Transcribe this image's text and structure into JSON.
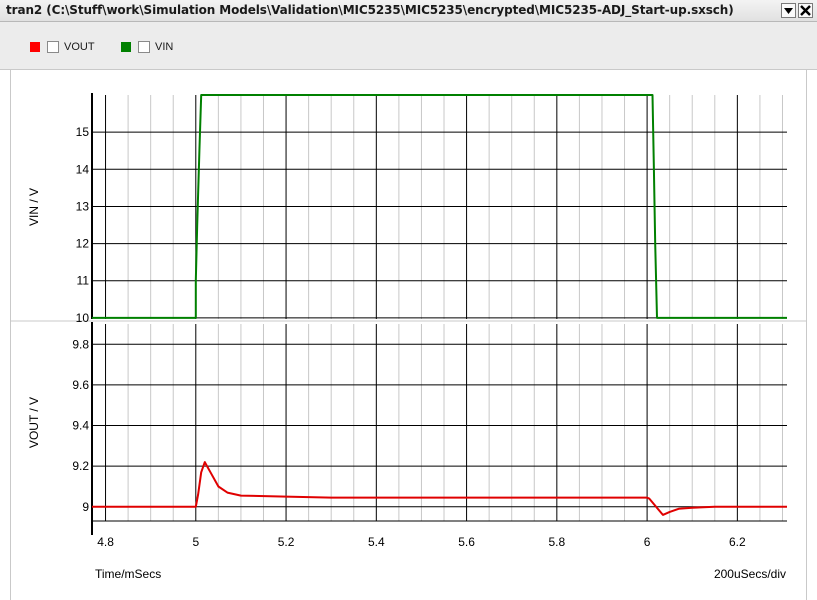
{
  "window": {
    "title": "tran2 (C:\\Stuff\\work\\Simulation Models\\Validation\\MIC5235\\MIC5235\\encrypted\\MIC5235-ADJ_Start-up.sxsch)",
    "menu_icon": "dropdown-triangle-icon",
    "close_icon": "close-x-icon"
  },
  "legend": [
    {
      "label": "VOUT",
      "color": "#ff0000",
      "checked": false
    },
    {
      "label": "VIN",
      "color": "#008000",
      "checked": false
    }
  ],
  "chart_data": [
    {
      "type": "line",
      "ylabel": "VIN / V",
      "yticks": [
        10,
        11,
        12,
        13,
        14,
        15
      ],
      "ylim": [
        9.97,
        16.0
      ],
      "xlim": [
        4.77,
        6.31
      ],
      "grid": true,
      "series": [
        {
          "name": "VIN",
          "color": "#008000",
          "x": [
            4.77,
            5.0,
            5.0,
            5.003,
            5.008,
            5.012,
            6.012,
            6.015,
            6.018,
            6.022,
            6.31
          ],
          "y": [
            10.0,
            10.0,
            11.0,
            12.5,
            14.5,
            16.0,
            16.0,
            14.0,
            12.0,
            10.0,
            10.0
          ]
        }
      ]
    },
    {
      "type": "line",
      "ylabel": "VOUT / V",
      "yticks": [
        9,
        9.2,
        9.4,
        9.6,
        9.8
      ],
      "ylim": [
        8.93,
        9.9
      ],
      "xlim": [
        4.77,
        6.31
      ],
      "grid": true,
      "xlabel": "Time/mSecs",
      "xdiv_label": "200uSecs/div",
      "xticks": [
        4.8,
        5,
        5.2,
        5.4,
        5.6,
        5.8,
        6,
        6.2
      ],
      "series": [
        {
          "name": "VOUT",
          "color": "#e00000",
          "x": [
            4.77,
            5.0,
            5.005,
            5.012,
            5.02,
            5.035,
            5.05,
            5.07,
            5.1,
            5.2,
            5.3,
            5.6,
            6.0,
            6.005,
            6.02,
            6.035,
            6.05,
            6.07,
            6.1,
            6.15,
            6.31
          ],
          "y": [
            9.0,
            9.0,
            9.06,
            9.17,
            9.22,
            9.16,
            9.1,
            9.07,
            9.055,
            9.05,
            9.045,
            9.045,
            9.045,
            9.04,
            9.0,
            8.96,
            8.975,
            8.99,
            8.995,
            9.0,
            9.0
          ]
        }
      ]
    }
  ]
}
